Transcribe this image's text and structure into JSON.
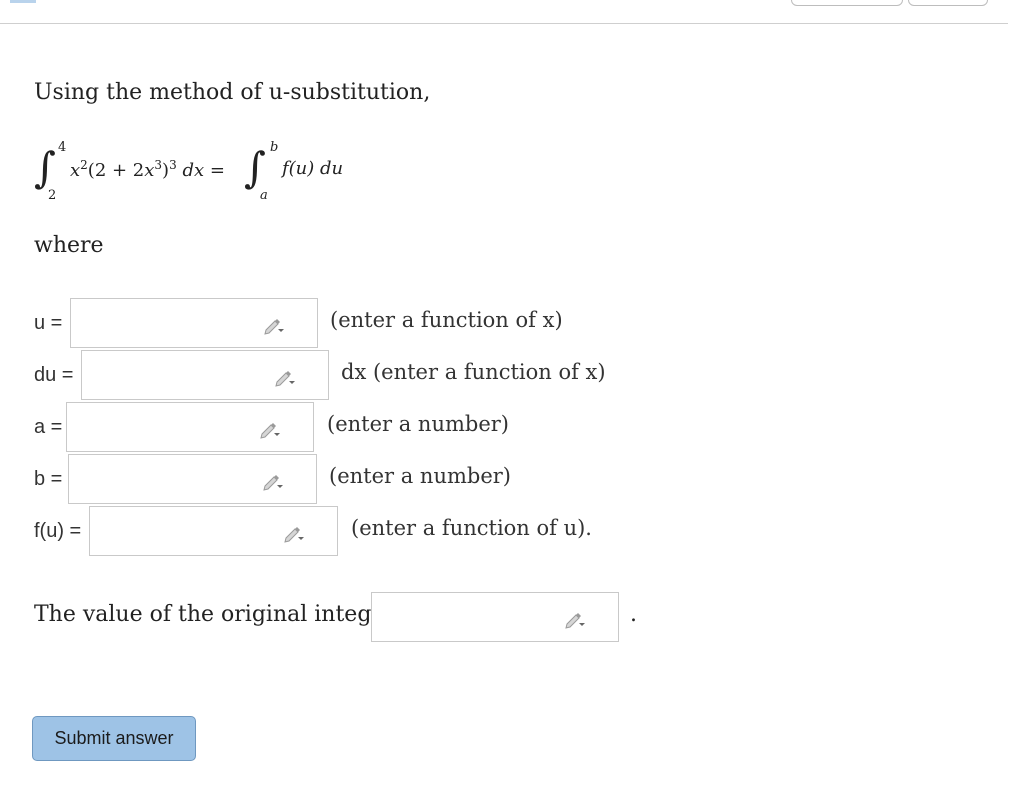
{
  "intro": "Using the method of u-substitution,",
  "formula": {
    "left_upper": "4",
    "left_lower": "2",
    "left_integrand": "x",
    "left_sq": "2",
    "left_paren": "(2 + 2x",
    "left_cube": "3",
    "left_close": ")",
    "left_pow": "3",
    "left_dx": " dx =",
    "right_upper": "b",
    "right_lower": "a",
    "right_integrand": "f(u) du"
  },
  "where": "where",
  "fields": [
    {
      "label": "u =",
      "hint": "(enter a function of x)",
      "value": ""
    },
    {
      "label": "du =",
      "hint": "dx (enter a function of x)",
      "value": ""
    },
    {
      "label": "a =",
      "hint": "(enter a number)",
      "value": ""
    },
    {
      "label": "b =",
      "hint": "(enter a number)",
      "value": ""
    },
    {
      "label": "f(u) =",
      "hint": "(enter a function of u).",
      "value": ""
    }
  ],
  "value_line": {
    "text": "The value of the original integral is",
    "period": ".",
    "value": ""
  },
  "submit_label": "Submit answer",
  "icons": {
    "editor": "pencil-dropdown-icon"
  },
  "colors": {
    "submit_bg": "#9ec3e6",
    "submit_border": "#6f98c0",
    "box_border": "#c9c9c9"
  }
}
